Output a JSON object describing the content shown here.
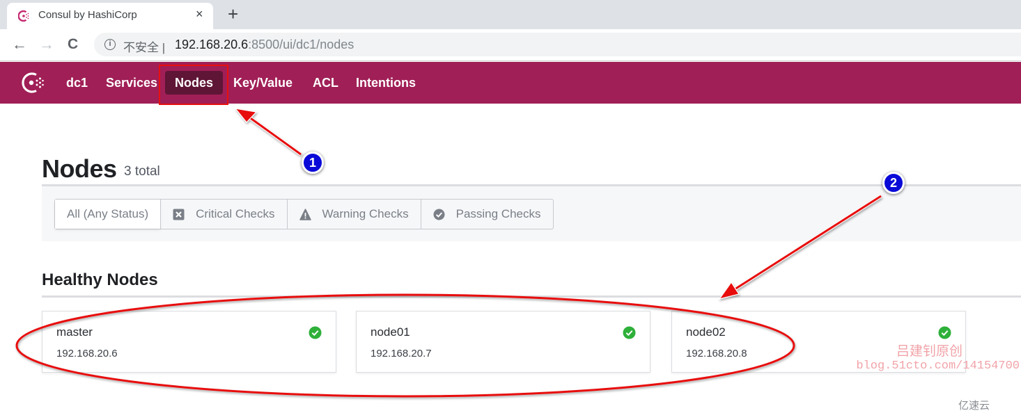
{
  "browser": {
    "tab_title": "Consul by HashiCorp",
    "tab_close": "×",
    "new_tab": "+",
    "nav": {
      "back": "←",
      "forward": "→",
      "reload": "C"
    },
    "security_label": "不安全",
    "url_host": "192.168.20.6",
    "url_rest": ":8500/ui/dc1/nodes"
  },
  "consul_nav": {
    "logo": "consul-logo-icon",
    "items": [
      {
        "label": "dc1",
        "active": false
      },
      {
        "label": "Services",
        "active": false
      },
      {
        "label": "Nodes",
        "active": true
      },
      {
        "label": "Key/Value",
        "active": false
      },
      {
        "label": "ACL",
        "active": false
      },
      {
        "label": "Intentions",
        "active": false
      }
    ]
  },
  "page": {
    "title": "Nodes",
    "count": "3 total"
  },
  "filters": [
    {
      "label": "All (Any Status)",
      "icon": "",
      "selected": true
    },
    {
      "label": "Critical Checks",
      "icon": "critical-x-icon",
      "selected": false
    },
    {
      "label": "Warning Checks",
      "icon": "warning-triangle-icon",
      "selected": false
    },
    {
      "label": "Passing Checks",
      "icon": "passing-check-icon",
      "selected": false
    }
  ],
  "section": {
    "title": "Healthy Nodes"
  },
  "nodes": [
    {
      "name": "master",
      "address": "192.168.20.6",
      "status": "passing"
    },
    {
      "name": "node01",
      "address": "192.168.20.7",
      "status": "passing"
    },
    {
      "name": "node02",
      "address": "192.168.20.8",
      "status": "passing"
    }
  ],
  "colors": {
    "brand": "#a01f56",
    "brand_active": "#5f1535",
    "passing": "#2eb039",
    "annotation_red": "#e81010",
    "badge_blue": "#0a0ad8"
  },
  "annotations": {
    "badge_1": "1",
    "badge_2": "2",
    "watermark_line1": "吕建钊原创",
    "watermark_line2": "blog.51cto.com/14154700",
    "brand_mark": "亿速云"
  }
}
